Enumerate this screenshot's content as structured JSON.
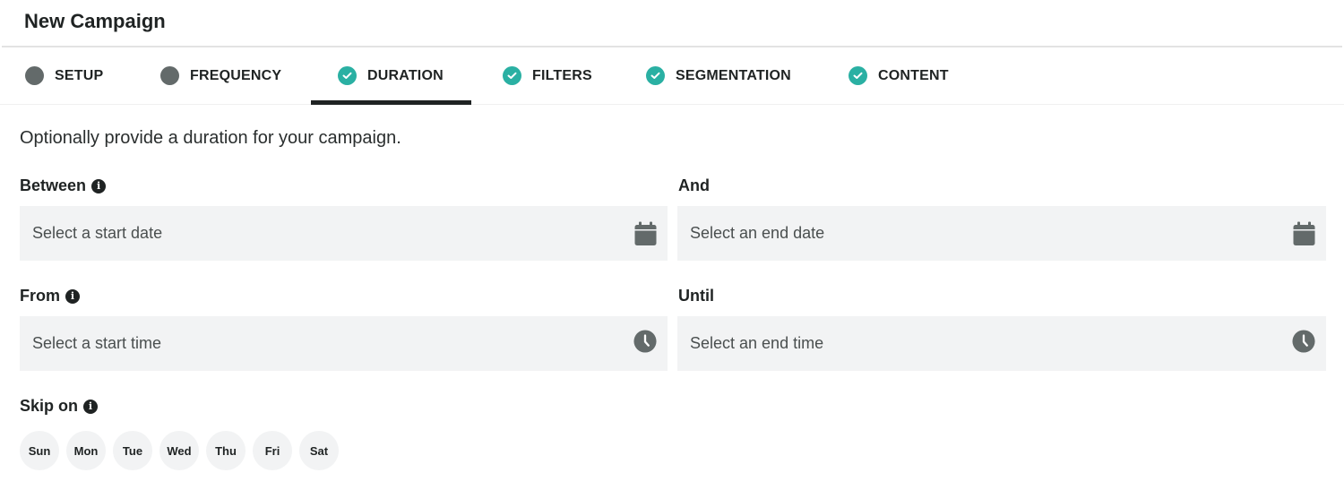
{
  "header": {
    "title": "New Campaign"
  },
  "tabs": [
    {
      "label": "SETUP",
      "status": "incomplete"
    },
    {
      "label": "FREQUENCY",
      "status": "incomplete"
    },
    {
      "label": "DURATION",
      "status": "complete",
      "active": true
    },
    {
      "label": "FILTERS",
      "status": "complete"
    },
    {
      "label": "SEGMENTATION",
      "status": "complete"
    },
    {
      "label": "CONTENT",
      "status": "complete"
    }
  ],
  "colors": {
    "accent": "#2ab0a3",
    "incomplete": "#636a6a",
    "text": "#1f2323",
    "input_bg": "#f2f3f4"
  },
  "intro": "Optionally provide a duration for your campaign.",
  "fields": {
    "between": {
      "label": "Between",
      "placeholder": "Select a start date",
      "icon": "calendar-icon"
    },
    "and": {
      "label": "And",
      "placeholder": "Select an end date",
      "icon": "calendar-icon"
    },
    "from": {
      "label": "From",
      "placeholder": "Select a start time",
      "icon": "clock-icon"
    },
    "until": {
      "label": "Until",
      "placeholder": "Select an end time",
      "icon": "clock-icon"
    }
  },
  "info_glyph": "i",
  "skip": {
    "label": "Skip on",
    "days": [
      "Sun",
      "Mon",
      "Tue",
      "Wed",
      "Thu",
      "Fri",
      "Sat"
    ]
  }
}
